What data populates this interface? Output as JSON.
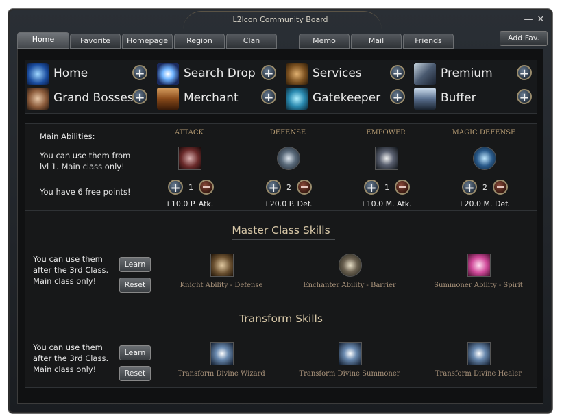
{
  "window": {
    "title": "L2Icon Community Board",
    "close_glyph": "✕"
  },
  "tabs": [
    {
      "label": "Home"
    },
    {
      "label": "Favorite"
    },
    {
      "label": "Homepage"
    },
    {
      "label": "Region"
    },
    {
      "label": "Clan"
    },
    {
      "label": "Memo"
    },
    {
      "label": "Mail"
    },
    {
      "label": "Friends"
    }
  ],
  "add_fav_label": "Add Fav.",
  "nav": {
    "plus_glyph": "+",
    "items": [
      {
        "label": "Home",
        "icon": "home-icon"
      },
      {
        "label": "Search Drop",
        "icon": "search-drop-icon"
      },
      {
        "label": "Services",
        "icon": "services-icon"
      },
      {
        "label": "Premium",
        "icon": "premium-icon"
      },
      {
        "label": "Grand Bosses",
        "icon": "grand-bosses-icon"
      },
      {
        "label": "Merchant",
        "icon": "merchant-icon"
      },
      {
        "label": "Gatekeeper",
        "icon": "gatekeeper-icon"
      },
      {
        "label": "Buffer",
        "icon": "buffer-icon"
      }
    ]
  },
  "abilities": {
    "title": "Main Abilities:",
    "desc_line1": "You can use them from",
    "desc_line2": "lvl 1. Main class only!",
    "free_points": "You have 6 free points!",
    "columns": [
      {
        "name": "ATTACK",
        "points": "1",
        "bonus": "+10.0 P. Atk."
      },
      {
        "name": "DEFENSE",
        "points": "2",
        "bonus": "+20.0 P. Def."
      },
      {
        "name": "EMPOWER",
        "points": "1",
        "bonus": "+10.0 M. Atk."
      },
      {
        "name": "MAGIC DEFENSE",
        "points": "2",
        "bonus": "+20.0 M. Def."
      }
    ]
  },
  "master": {
    "title": "Master Class Skills",
    "desc_line1": "You can use them",
    "desc_line2": "after the 3rd Class.",
    "desc_line3": "Main class only!",
    "learn_label": "Learn",
    "reset_label": "Reset",
    "skills": [
      {
        "name": "Knight Ability - Defense"
      },
      {
        "name": "Enchanter Ability - Barrier"
      },
      {
        "name": "Summoner Ability - Spirit"
      }
    ]
  },
  "transform": {
    "title": "Transform Skills",
    "desc_line1": "You can use them",
    "desc_line2": "after the 3rd Class.",
    "desc_line3": "Main class only!",
    "learn_label": "Learn",
    "reset_label": "Reset",
    "skills": [
      {
        "name": "Transform Divine Wizard"
      },
      {
        "name": "Transform Divine Summoner"
      },
      {
        "name": "Transform Divine Healer"
      }
    ]
  }
}
